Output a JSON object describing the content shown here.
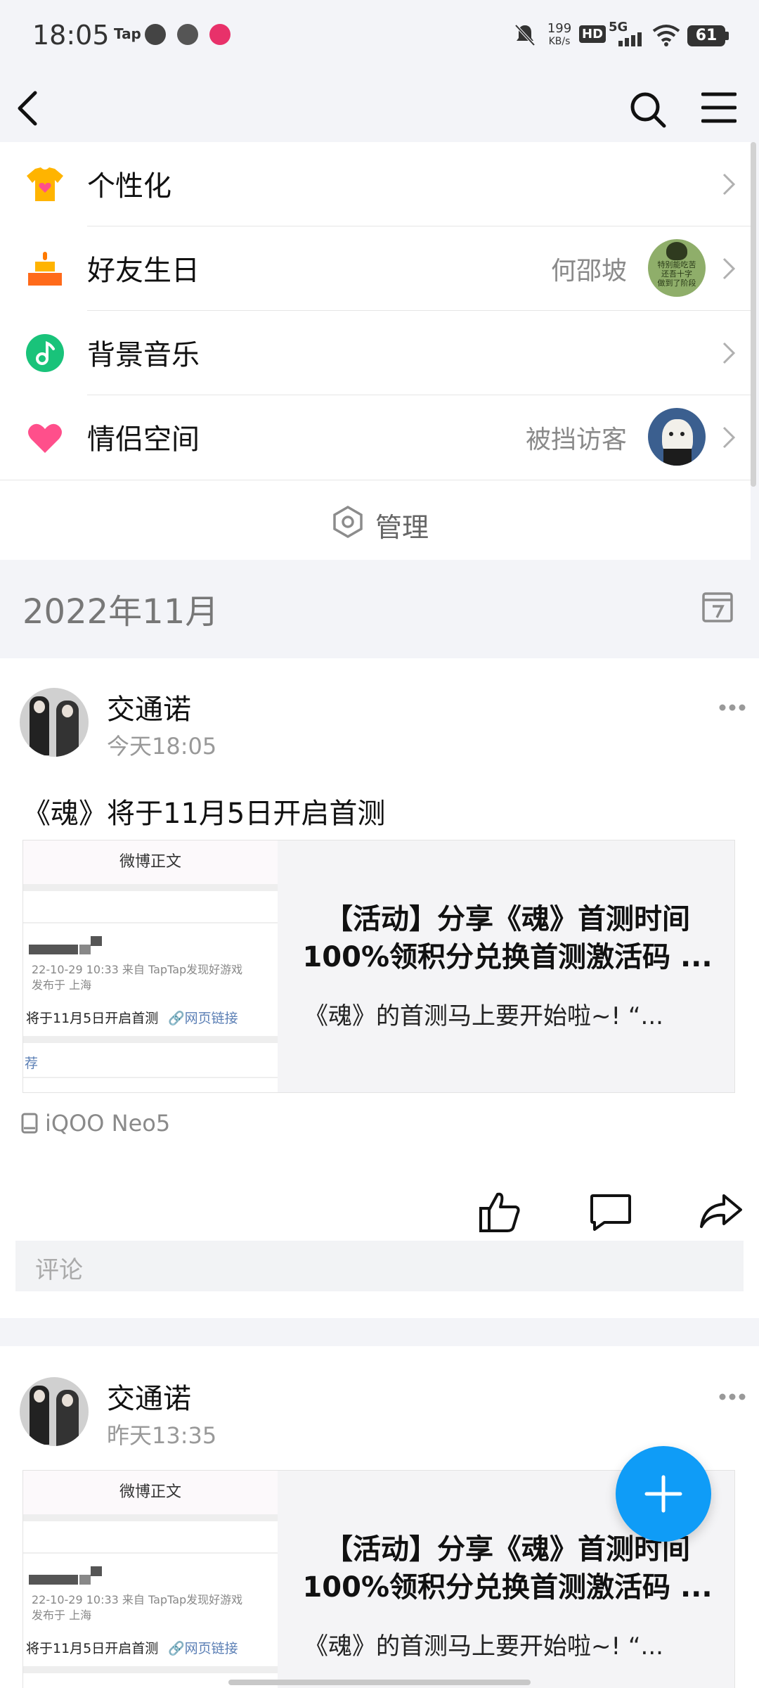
{
  "status_bar": {
    "time": "18:05",
    "app_tap": "Tap",
    "net_speed_value": "199",
    "net_speed_unit": "KB/s",
    "hd": "HD",
    "network": "5G",
    "battery": "61"
  },
  "menu": {
    "items": [
      {
        "label": "个性化",
        "value": "",
        "icon": "tshirt-icon"
      },
      {
        "label": "好友生日",
        "value": "何邵坡",
        "icon": "cake-icon"
      },
      {
        "label": "背景音乐",
        "value": "",
        "icon": "music-icon"
      },
      {
        "label": "情侣空间",
        "value": "被挡访客",
        "icon": "heart-icon"
      }
    ],
    "avatar1_text_1": "特别能吃苦",
    "avatar1_text_2": "还吾十字",
    "avatar1_text_3": "做到了阶段",
    "manage_label": "管理"
  },
  "month": {
    "label": "2022年11月"
  },
  "posts": [
    {
      "author": "交通诺",
      "time": "今天18:05",
      "text": "《魂》将于11月5日开启首测",
      "link": {
        "thumb_header": "微博正文",
        "thumb_meta1": "22-10-29 10:33  来自 TapTap发现好游戏",
        "thumb_meta2": "发布于 上海",
        "thumb_main": "将于11月5日开启首测",
        "thumb_link": "🔗网页链接",
        "thumb_footer": "荐",
        "title_line1": "【活动】分享《魂》首测时间",
        "title_line2": "100%领积分兑换首测激活码 ...",
        "desc": "《魂》的首测马上要开始啦~!   “..."
      },
      "device": "iQOO Neo5",
      "comment_placeholder": "评论"
    },
    {
      "author": "交通诺",
      "time": "昨天13:35",
      "link": {
        "thumb_header": "微博正文",
        "thumb_meta1": "22-10-29 10:33  来自 TapTap发现好游戏",
        "thumb_meta2": "发布于 上海",
        "thumb_main": "将于11月5日开启首测",
        "thumb_link": "🔗网页链接",
        "title_line1": "【活动】分享《魂》首测时间",
        "title_line2": "100%领积分兑换首测激活码 ...",
        "desc": "《魂》的首测马上要开始啦~!   “..."
      }
    }
  ],
  "colors": {
    "accent": "#0f9cf7",
    "heart": "#ff4f8b",
    "music": "#19c37a",
    "tshirt": "#ffb400"
  }
}
